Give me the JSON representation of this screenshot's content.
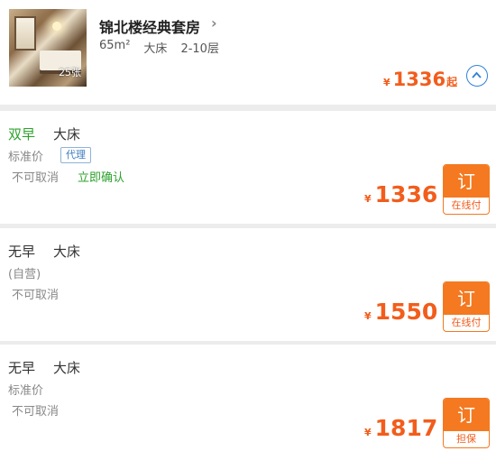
{
  "room": {
    "title": "锦北楼经典套房",
    "chevron": "›",
    "area": "65m²",
    "bed": "大床",
    "floor": "2-10层",
    "photo_count": "25张",
    "price_currency": "¥",
    "price": "1336",
    "price_suffix": "起",
    "collapse_icon": "chevron-up-circle-icon"
  },
  "colors": {
    "accent_orange": "#f47920",
    "price_orange": "#f25d1c",
    "green": "#2ea12e",
    "link_blue": "#2e82d6"
  },
  "plans": [
    {
      "breakfast": "双早",
      "breakfast_color": "#2ea12e",
      "bed": "大床",
      "rate_type": "标准价",
      "tag": "代理",
      "cancel": "不可取消",
      "confirm": "立即确认",
      "currency": "¥",
      "price": "1336",
      "book_label": "订",
      "pay_label": "在线付"
    },
    {
      "breakfast": "无早",
      "bed": "大床",
      "rate_type": "(自营)",
      "cancel": "不可取消",
      "currency": "¥",
      "price": "1550",
      "book_label": "订",
      "pay_label": "在线付"
    },
    {
      "breakfast": "无早",
      "bed": "大床",
      "rate_type": "标准价",
      "cancel": "不可取消",
      "currency": "¥",
      "price": "1817",
      "book_label": "订",
      "pay_label": "担保"
    }
  ]
}
